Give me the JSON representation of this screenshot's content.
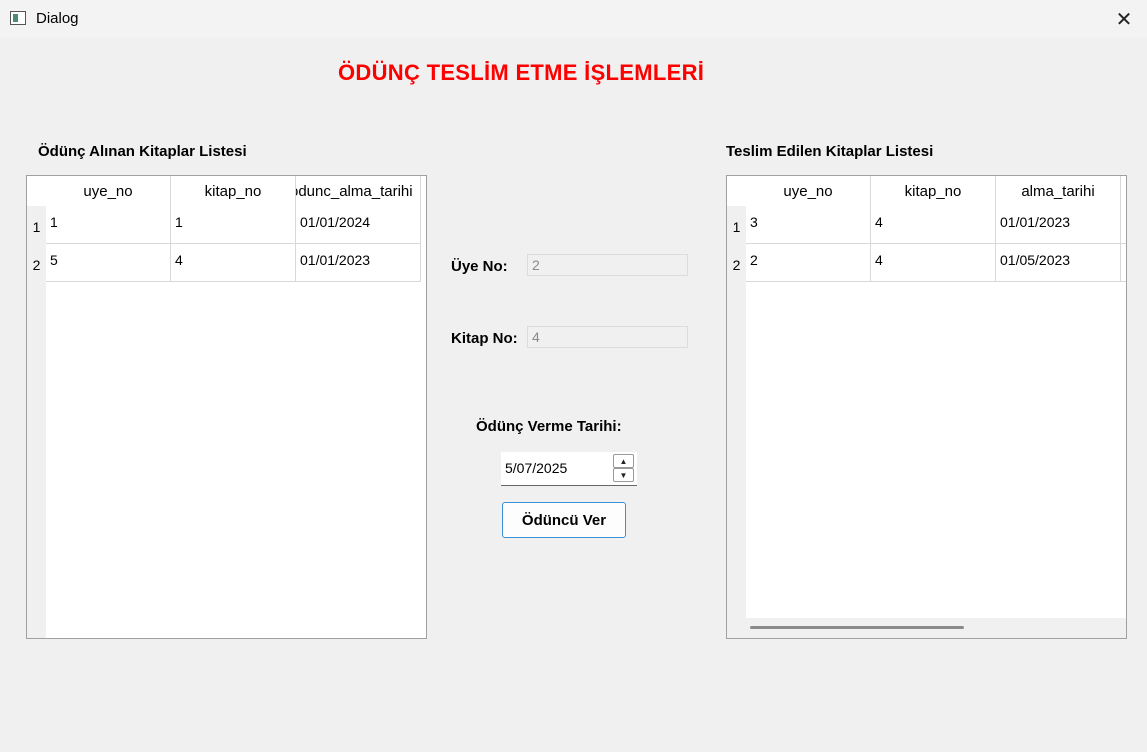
{
  "window": {
    "title": "Dialog",
    "close_glyph": "✕"
  },
  "main_title": "ÖDÜNÇ TESLİM ETME İŞLEMLERİ",
  "left_table": {
    "label": "Ödünç Alınan Kitaplar Listesi",
    "headers": [
      "uye_no",
      "kitap_no",
      "odunc_alma_tarihi"
    ],
    "rows": [
      {
        "num": "1",
        "cells": [
          "1",
          "1",
          "01/01/2024"
        ]
      },
      {
        "num": "2",
        "cells": [
          "5",
          "4",
          "01/01/2023"
        ]
      }
    ]
  },
  "right_table": {
    "label": "Teslim Edilen Kitaplar Listesi",
    "headers": [
      "uye_no",
      "kitap_no",
      "alma_tarihi"
    ],
    "rows": [
      {
        "num": "1",
        "cells": [
          "3",
          "4",
          "01/01/2023"
        ]
      },
      {
        "num": "2",
        "cells": [
          "2",
          "4",
          "01/05/2023"
        ]
      }
    ]
  },
  "form": {
    "uye_no_label": "Üye No:",
    "uye_no_value": "2",
    "kitap_no_label": "Kitap No:",
    "kitap_no_value": "4",
    "date_label": "Ödünç Verme Tarihi:",
    "date_value": "5/07/2025",
    "spin_up": "▲",
    "spin_down": "▼",
    "submit_label": "Ödüncü Ver"
  },
  "colors": {
    "title_red": "#ff0000",
    "button_border": "#3a8fd6"
  }
}
